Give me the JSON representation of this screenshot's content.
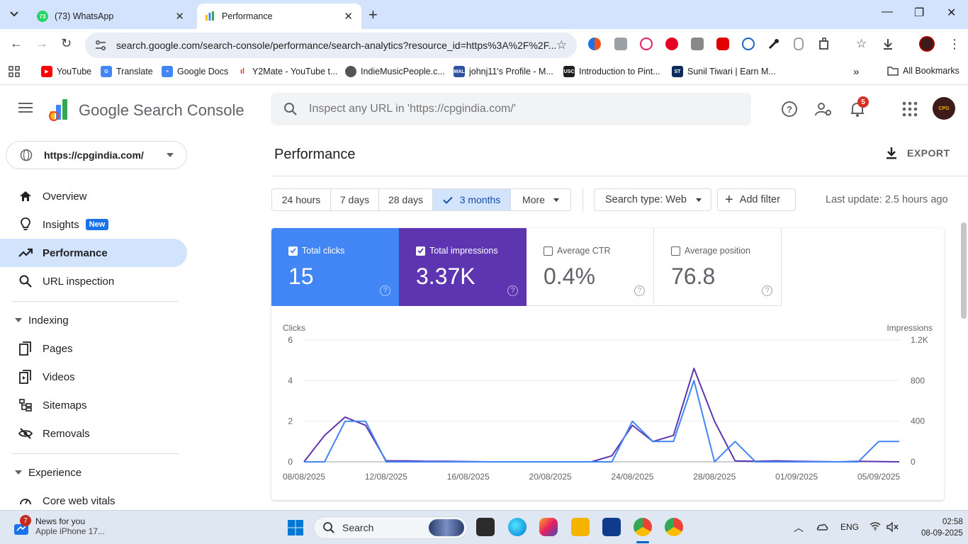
{
  "browser": {
    "tabs": [
      {
        "label": "(73) WhatsApp",
        "badge": "73"
      },
      {
        "label": "Performance"
      }
    ],
    "url": "search.google.com/search-console/performance/search-analytics?resource_id=https%3A%2F%2F...",
    "bookmarks": [
      {
        "label": "YouTube",
        "icon": "youtube-icon"
      },
      {
        "label": "Translate",
        "icon": "translate-icon"
      },
      {
        "label": "Google Docs",
        "icon": "docs-icon"
      },
      {
        "label": "Y2Mate - YouTube t...",
        "icon": "y2mate-icon"
      },
      {
        "label": "IndieMusicPeople.c...",
        "icon": "globe-icon"
      },
      {
        "label": "johnj11's Profile - M...",
        "icon": "mal-icon",
        "icon_text": "MAL"
      },
      {
        "label": "Introduction to Pint...",
        "icon": "usc-icon",
        "icon_text": "USC"
      },
      {
        "label": "Sunil Tiwari | Earn M...",
        "icon": "st-icon",
        "icon_text": "ST"
      }
    ],
    "all_bookmarks": "All Bookmarks"
  },
  "gsc": {
    "brand": "Google Search Console",
    "inspect_placeholder": "Inspect any URL in 'https://cpgindia.com/'",
    "notifications": "5",
    "avatar_text": "CPG",
    "property": "https://cpgindia.com/",
    "nav": [
      {
        "label": "Overview",
        "icon": "home-icon"
      },
      {
        "label": "Insights",
        "icon": "lightbulb-icon",
        "badge": "New"
      },
      {
        "label": "Performance",
        "icon": "trending-icon",
        "active": true
      },
      {
        "label": "URL inspection",
        "icon": "search-icon"
      }
    ],
    "sections": [
      {
        "label": "Indexing",
        "items": [
          {
            "label": "Pages",
            "icon": "pages-icon"
          },
          {
            "label": "Videos",
            "icon": "video-icon"
          },
          {
            "label": "Sitemaps",
            "icon": "sitemap-icon"
          },
          {
            "label": "Removals",
            "icon": "eye-off-icon"
          }
        ]
      },
      {
        "label": "Experience",
        "items": [
          {
            "label": "Core web vitals",
            "icon": "gauge-icon"
          }
        ]
      }
    ]
  },
  "main": {
    "title": "Performance",
    "export_label": "EXPORT",
    "date_ranges": [
      "24 hours",
      "7 days",
      "28 days",
      "3 months",
      "More"
    ],
    "selected_range": "3 months",
    "search_type": "Search type: Web",
    "add_filter": "Add filter",
    "last_update": "Last update: 2.5 hours ago",
    "metrics": [
      {
        "label": "Total clicks",
        "value": "15",
        "checked": true,
        "color": "#4285f4"
      },
      {
        "label": "Total impressions",
        "value": "3.37K",
        "checked": true,
        "color": "#5e35b1"
      },
      {
        "label": "Average CTR",
        "value": "0.4%",
        "checked": false
      },
      {
        "label": "Average position",
        "value": "76.8",
        "checked": false
      }
    ]
  },
  "chart_data": {
    "type": "line",
    "ylabel_left": "Clicks",
    "ylabel_right": "Impressions",
    "y_left_ticks": [
      "0",
      "2",
      "4",
      "6"
    ],
    "y_right_ticks": [
      "0",
      "400",
      "800",
      "1.2K"
    ],
    "ylim_left": [
      0,
      6
    ],
    "ylim_right": [
      0,
      1200
    ],
    "x_tick_labels": [
      "08/08/2025",
      "12/08/2025",
      "16/08/2025",
      "20/08/2025",
      "24/08/2025",
      "28/08/2025",
      "01/09/2025",
      "05/09/2025"
    ],
    "x_start": "2025-08-08",
    "x_end": "2025-09-06",
    "grid": true,
    "series": [
      {
        "name": "Clicks",
        "axis": "left",
        "color": "#4285f4",
        "values": [
          0,
          0,
          2,
          2,
          0,
          0,
          0,
          0,
          0,
          0,
          0,
          0,
          0,
          0,
          0,
          0,
          2,
          1,
          1,
          4,
          0,
          1,
          0,
          0,
          0,
          0,
          0,
          0,
          1,
          1
        ]
      },
      {
        "name": "Impressions",
        "axis": "right",
        "color": "#5e35b1",
        "values": [
          0,
          260,
          440,
          360,
          10,
          10,
          5,
          5,
          3,
          0,
          0,
          0,
          0,
          0,
          0,
          60,
          360,
          200,
          260,
          920,
          400,
          10,
          5,
          10,
          5,
          3,
          0,
          5,
          3,
          0
        ]
      }
    ]
  },
  "taskbar": {
    "news_badge": "7",
    "news_title": "News for you",
    "news_sub": "Apple iPhone 17...",
    "search_label": "Search",
    "lang": "ENG",
    "time": "02:58",
    "date": "08-09-2025"
  }
}
